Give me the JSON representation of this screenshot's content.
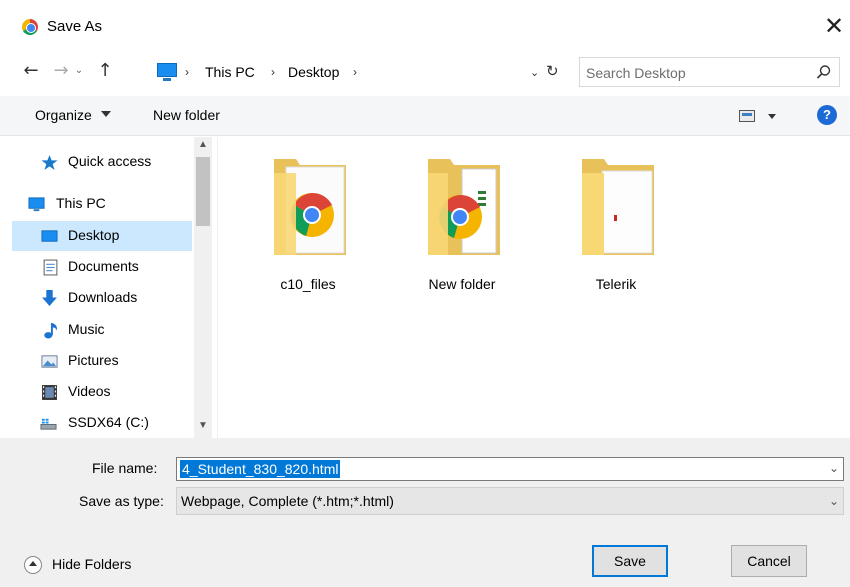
{
  "window": {
    "title": "Save As",
    "close_glyph": "✕"
  },
  "nav": {
    "back_glyph": "←",
    "forward_glyph": "→",
    "recent_glyph": "⌄",
    "up_glyph": "↑",
    "breadcrumb": [
      "This PC",
      "Desktop"
    ],
    "separator": "›",
    "refresh_glyph": "↻",
    "dropdown_glyph": "⌄"
  },
  "search": {
    "placeholder": "Search Desktop"
  },
  "toolbar": {
    "organize_label": "Organize",
    "new_folder_label": "New folder",
    "help_glyph": "?"
  },
  "sidebar": {
    "items": [
      {
        "label": "Quick access",
        "icon": "star-icon"
      },
      {
        "label": "This PC",
        "icon": "computer-icon"
      },
      {
        "label": "Desktop",
        "icon": "desktop-icon",
        "selected": true
      },
      {
        "label": "Documents",
        "icon": "documents-icon"
      },
      {
        "label": "Downloads",
        "icon": "downloads-icon"
      },
      {
        "label": "Music",
        "icon": "music-icon"
      },
      {
        "label": "Pictures",
        "icon": "pictures-icon"
      },
      {
        "label": "Videos",
        "icon": "videos-icon"
      },
      {
        "label": "SSDX64 (C:)",
        "icon": "drive-icon"
      }
    ],
    "scroll_up_glyph": "▲",
    "scroll_down_glyph": "▼"
  },
  "files": [
    {
      "name": "c10_files",
      "icon": "folder-chrome-icon"
    },
    {
      "name": "New folder",
      "icon": "folder-chrome-doc-icon"
    },
    {
      "name": "Telerik",
      "icon": "folder-icon"
    }
  ],
  "form": {
    "file_name_label": "File name:",
    "file_name_value": "4_Student_830_820.html",
    "save_type_label": "Save as type:",
    "save_type_value": "Webpage, Complete (*.htm;*.html)",
    "dropdown_glyph": "⌄"
  },
  "footer": {
    "hide_folders_label": "Hide Folders",
    "save_label": "Save",
    "cancel_label": "Cancel"
  },
  "colors": {
    "selection": "#cce8ff",
    "accent": "#0078d7",
    "folder": "#f8d775"
  }
}
